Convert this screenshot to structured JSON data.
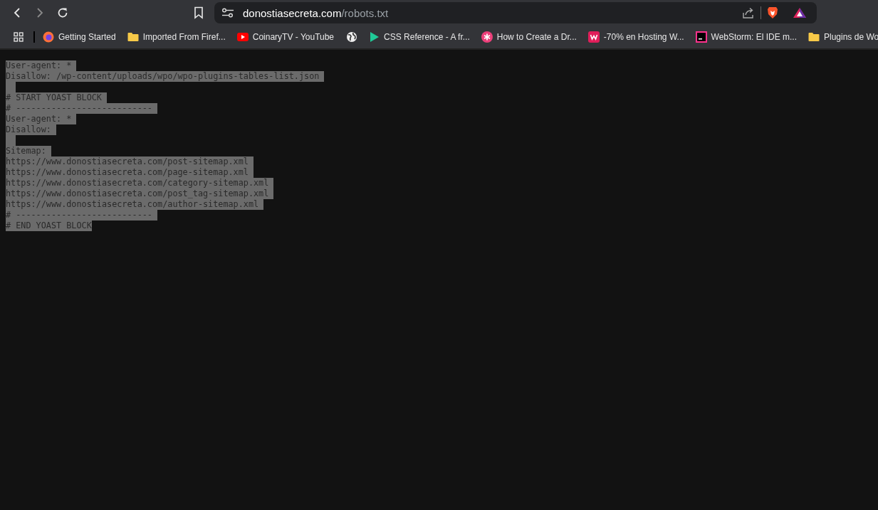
{
  "toolbar": {
    "address": {
      "host": "donostiasecreta.com",
      "path": "/robots.txt"
    }
  },
  "bookmarks": [
    {
      "kind": "link",
      "label": "Getting Started"
    },
    {
      "kind": "folder",
      "label": "Imported From Firef..."
    },
    {
      "kind": "link",
      "label": "CoinaryTV - YouTube"
    },
    {
      "kind": "icon_only"
    },
    {
      "kind": "link",
      "label": "CSS Reference - A fr..."
    },
    {
      "kind": "link",
      "label": "How to Create a Dr..."
    },
    {
      "kind": "link",
      "label": "-70% en Hosting W..."
    },
    {
      "kind": "link",
      "label": "WebStorm: El IDE m..."
    },
    {
      "kind": "folder",
      "label": "Plugins de Wo"
    }
  ],
  "document": {
    "selected": true,
    "lines": [
      {
        "kind": "text",
        "text": "User-agent: *"
      },
      {
        "kind": "text",
        "text": "Disallow: /wp-content/uploads/wpo/wpo-plugins-tables-list.json"
      },
      {
        "kind": "blank"
      },
      {
        "kind": "text",
        "text": "# START YOAST BLOCK"
      },
      {
        "kind": "text",
        "text": "# ---------------------------"
      },
      {
        "kind": "text",
        "text": "User-agent: *"
      },
      {
        "kind": "text",
        "text": "Disallow:"
      },
      {
        "kind": "blank"
      },
      {
        "kind": "text",
        "text": "Sitemap:"
      },
      {
        "kind": "text",
        "text": "https://www.donostiasecreta.com/post-sitemap.xml"
      },
      {
        "kind": "text",
        "text": "https://www.donostiasecreta.com/page-sitemap.xml"
      },
      {
        "kind": "text",
        "text": "https://www.donostiasecreta.com/category-sitemap.xml"
      },
      {
        "kind": "text",
        "text": "https://www.donostiasecreta.com/post_tag-sitemap.xml"
      },
      {
        "kind": "text",
        "text": "https://www.donostiasecreta.com/author-sitemap.xml"
      },
      {
        "kind": "text",
        "text": "# ---------------------------"
      },
      {
        "kind": "text",
        "text": "# END YOAST BLOCK"
      }
    ]
  }
}
